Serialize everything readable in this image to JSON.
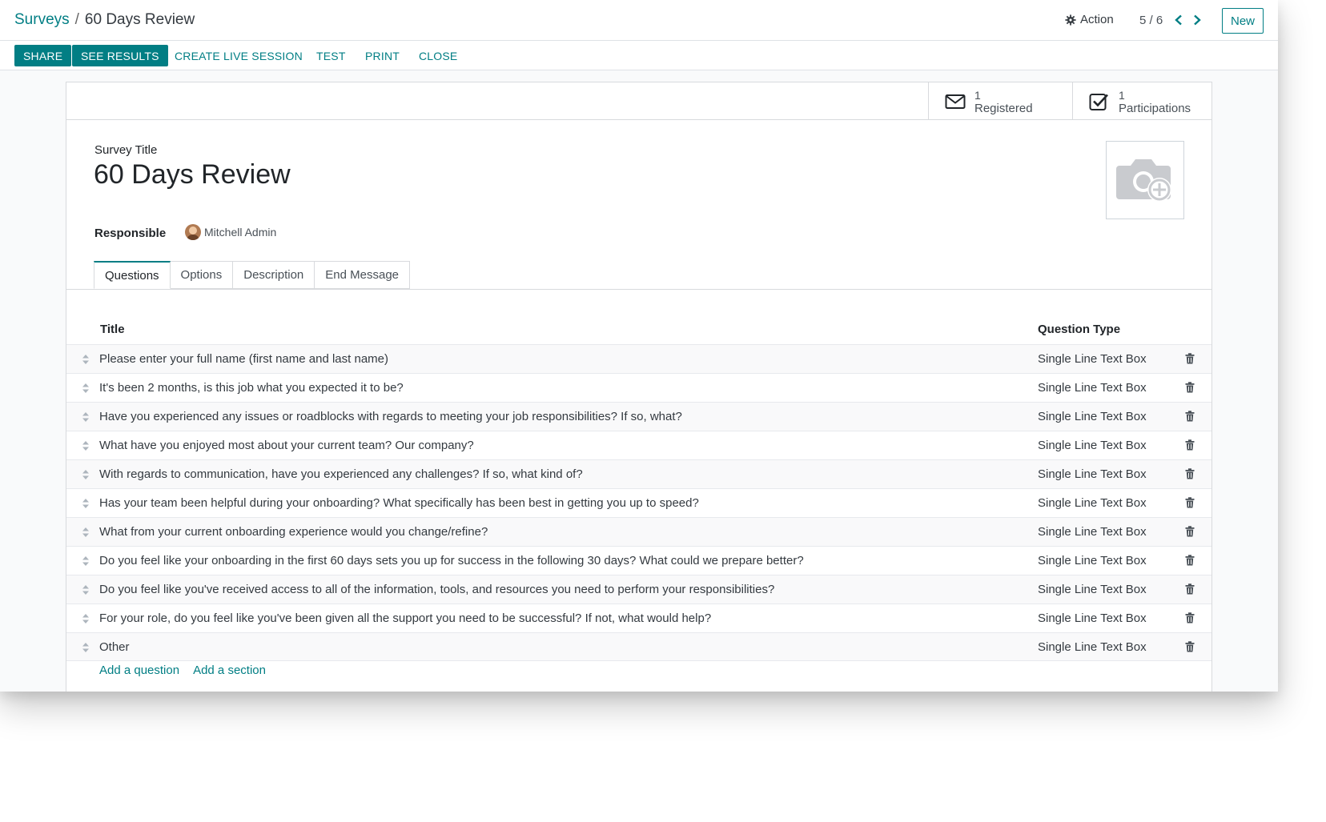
{
  "breadcrumb": {
    "parent": "Surveys",
    "separator": "/",
    "current": "60 Days Review"
  },
  "control_panel": {
    "action_label": "Action",
    "action_icon": "gear-icon",
    "pager": "5 / 6",
    "prev_icon": "chevron-left-icon",
    "next_icon": "chevron-right-icon",
    "new_label": "New"
  },
  "header_buttons": {
    "share": "SHARE",
    "see_results": "SEE RESULTS",
    "create_live_session": "CREATE LIVE SESSION",
    "test": "TEST",
    "print": "PRINT",
    "close": "CLOSE"
  },
  "stat_buttons": {
    "registered": {
      "count": "1",
      "label": "Registered",
      "icon": "envelope-icon"
    },
    "participations": {
      "count": "1",
      "label": "Participations",
      "icon": "checkbox-icon"
    }
  },
  "form": {
    "title_label": "Survey Title",
    "title_value": "60 Days Review",
    "responsible_label": "Responsible",
    "responsible_value": "Mitchell Admin",
    "image_icon": "camera-plus-icon"
  },
  "tabs": [
    "Questions",
    "Options",
    "Description",
    "End Message"
  ],
  "active_tab": "Questions",
  "questions": {
    "headers": {
      "title": "Title",
      "type": "Question Type"
    },
    "rows": [
      {
        "title": "Please enter your full name (first name and last name)",
        "type": "Single Line Text Box"
      },
      {
        "title": "It's been 2 months, is this job what you expected it to be?",
        "type": "Single Line Text Box"
      },
      {
        "title": "Have you experienced any issues or roadblocks with regards to meeting your job responsibilities? If so, what?",
        "type": "Single Line Text Box"
      },
      {
        "title": "What have you enjoyed most about your current team? Our company?",
        "type": "Single Line Text Box"
      },
      {
        "title": "With regards to communication, have you experienced any challenges? If so, what kind of?",
        "type": "Single Line Text Box"
      },
      {
        "title": "Has your team been helpful during your onboarding? What specifically has been best in getting you up to speed?",
        "type": "Single Line Text Box"
      },
      {
        "title": "What from your current onboarding experience would you change/refine?",
        "type": "Single Line Text Box"
      },
      {
        "title": "Do you feel like your onboarding in the first 60 days sets you up for success in the following 30 days? What could we prepare better?",
        "type": "Single Line Text Box"
      },
      {
        "title": "Do you feel like you've received access to all of the information, tools, and resources you need to perform your responsibilities?",
        "type": "Single Line Text Box"
      },
      {
        "title": "For your role, do you feel like you've been given all the support you need to be successful? If not, what would help?",
        "type": "Single Line Text Box"
      },
      {
        "title": "Other",
        "type": "Single Line Text Box"
      }
    ],
    "add_question": "Add a question",
    "add_section": "Add a section"
  },
  "colors": {
    "brand": "#017e84",
    "text": "#212529",
    "muted": "#495057",
    "border": "#d8dadd"
  }
}
